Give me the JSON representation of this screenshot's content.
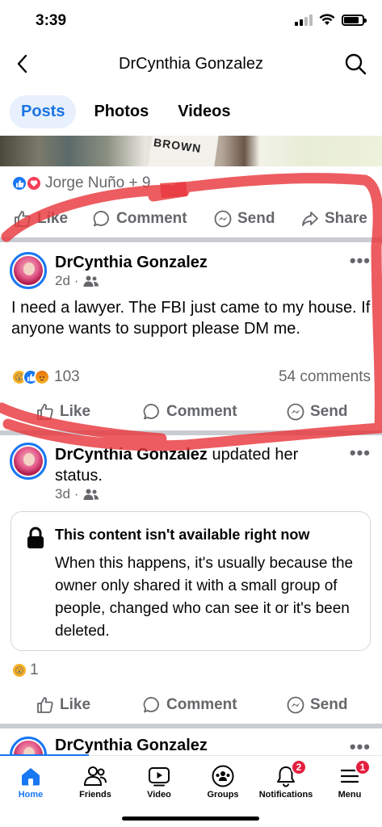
{
  "status_bar": {
    "time": "3:39"
  },
  "header": {
    "title": "DrCynthia Gonzalez"
  },
  "tabs": [
    {
      "label": "Posts",
      "active": true
    },
    {
      "label": "Photos",
      "active": false
    },
    {
      "label": "Videos",
      "active": false
    }
  ],
  "photo_sign_text": "BROWN",
  "post0": {
    "reactors": "Jorge Nuño + 9",
    "actions": {
      "like": "Like",
      "comment": "Comment",
      "send": "Send",
      "share": "Share"
    }
  },
  "post1": {
    "author": "DrCynthia Gonzalez",
    "time": "2d",
    "text": "I need a lawyer. The FBI just came to my house. If anyone wants to support please DM me.",
    "reaction_count": "103",
    "comment_count": "54 comments",
    "actions": {
      "like": "Like",
      "comment": "Comment",
      "send": "Send"
    }
  },
  "post2": {
    "author": "DrCynthia Gonzalez",
    "update_text": "updated her status.",
    "time": "3d",
    "unavailable_title": "This content isn't available right now",
    "unavailable_body": "When this happens, it's usually because the owner only shared it with a small group of people, changed who can see it or it's been deleted.",
    "reaction_count": "1",
    "actions": {
      "like": "Like",
      "comment": "Comment",
      "send": "Send"
    }
  },
  "post3": {
    "author": "DrCynthia Gonzalez"
  },
  "bottom_nav": [
    {
      "label": "Home",
      "icon": "home-icon",
      "active": true
    },
    {
      "label": "Friends",
      "icon": "friends-icon",
      "active": false
    },
    {
      "label": "Video",
      "icon": "video-icon",
      "active": false
    },
    {
      "label": "Groups",
      "icon": "groups-icon",
      "active": false
    },
    {
      "label": "Notifications",
      "icon": "bell-icon",
      "badge": "2",
      "active": false
    },
    {
      "label": "Menu",
      "icon": "menu-icon",
      "badge": "1",
      "active": false
    }
  ],
  "colors": {
    "accent": "#1877f2",
    "annotation": "#e8383d",
    "muted": "#65676b"
  }
}
